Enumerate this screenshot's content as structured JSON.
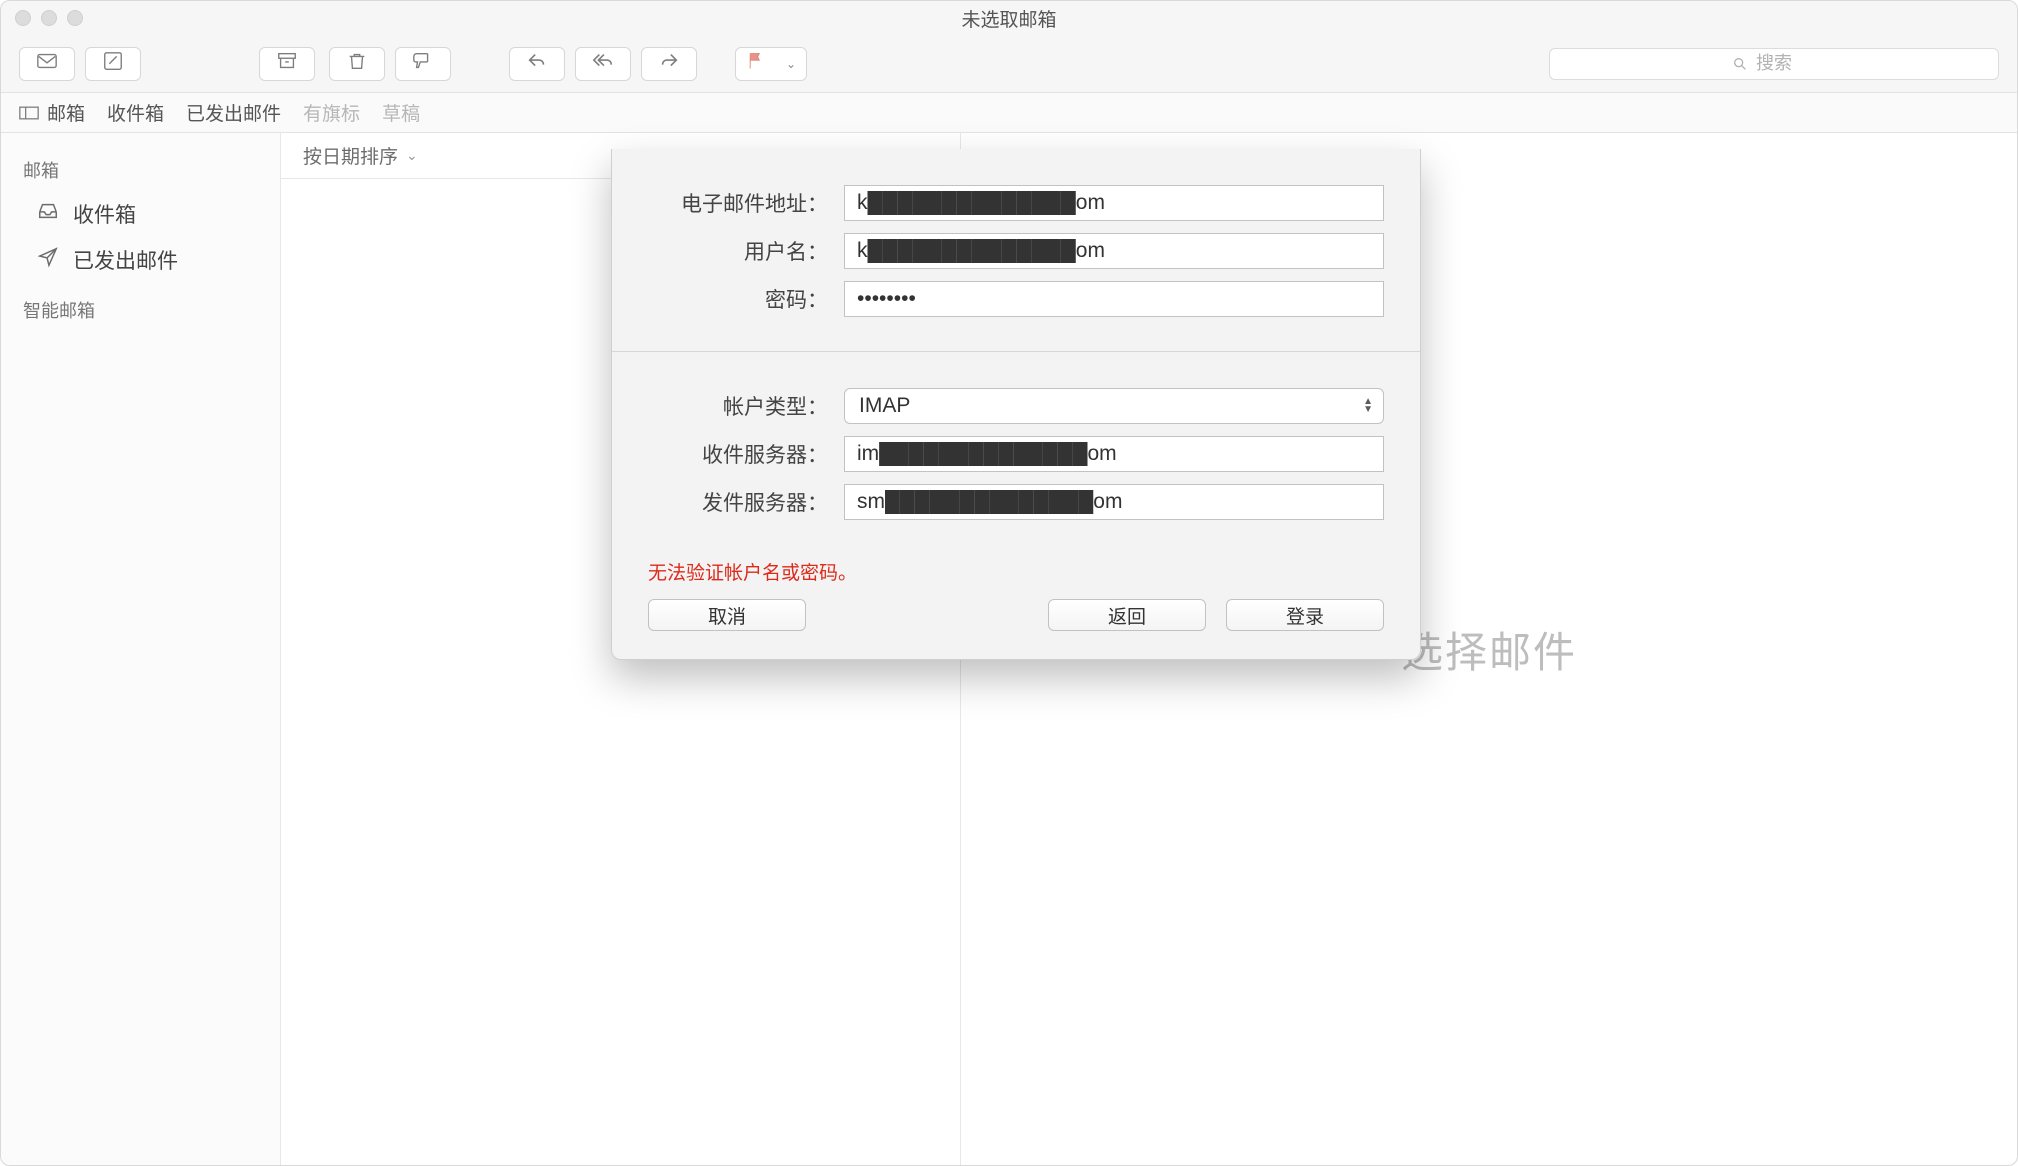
{
  "window": {
    "title": "未选取邮箱"
  },
  "toolbar": {
    "search_placeholder": "搜索"
  },
  "favbar": {
    "mailboxes": "邮箱",
    "inbox": "收件箱",
    "sent": "已发出邮件",
    "flagged": "有旗标",
    "drafts": "草稿"
  },
  "sidebar": {
    "heading_mailboxes": "邮箱",
    "inbox": "收件箱",
    "sent": "已发出邮件",
    "heading_smart": "智能邮箱"
  },
  "msg_list": {
    "sort_label": "按日期排序"
  },
  "viewer": {
    "placeholder": "选择邮件"
  },
  "dialog": {
    "labels": {
      "email": "电子邮件地址：",
      "user": "用户名：",
      "password": "密码：",
      "account_type": "帐户类型：",
      "incoming": "收件服务器：",
      "outgoing": "发件服务器："
    },
    "values": {
      "email_prefix": "k",
      "email_suffix": "om",
      "user_prefix": "k",
      "user_suffix": "om",
      "password": "••••••••",
      "account_type": "IMAP",
      "incoming_prefix": "im",
      "incoming_suffix": "om",
      "outgoing_prefix": "sm",
      "outgoing_suffix": "om"
    },
    "error": "无法验证帐户名或密码。",
    "buttons": {
      "cancel": "取消",
      "back": "返回",
      "signin": "登录"
    }
  }
}
